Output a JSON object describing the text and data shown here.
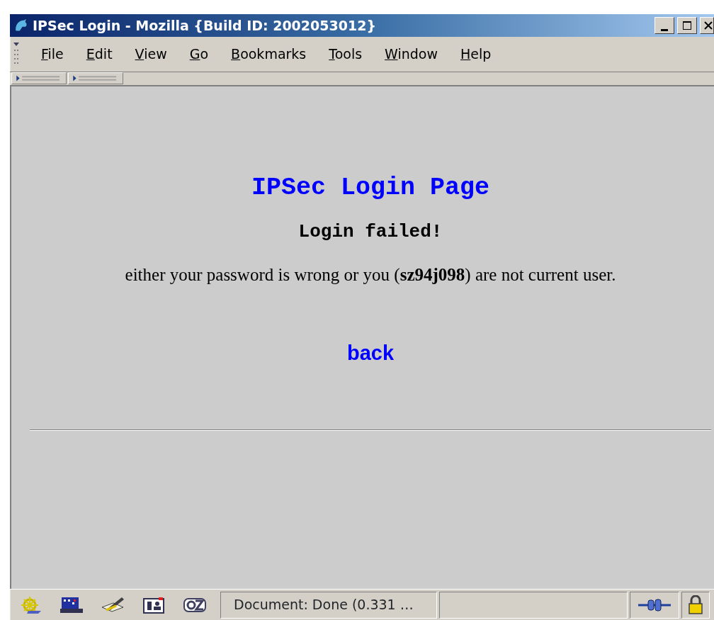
{
  "window": {
    "title": "IPSec Login - Mozilla {Build ID: 2002053012}"
  },
  "menu": [
    {
      "label": "File"
    },
    {
      "label": "Edit"
    },
    {
      "label": "View"
    },
    {
      "label": "Go"
    },
    {
      "label": "Bookmarks"
    },
    {
      "label": "Tools"
    },
    {
      "label": "Window"
    },
    {
      "label": "Help"
    }
  ],
  "page": {
    "heading": "IPSec Login Page",
    "subheading": "Login failed!",
    "message": "either your password is wrong or you (**sz94j098**) are not current user.",
    "link": "back"
  },
  "status_bar": {
    "text": "Document: Done (0.331 …"
  }
}
